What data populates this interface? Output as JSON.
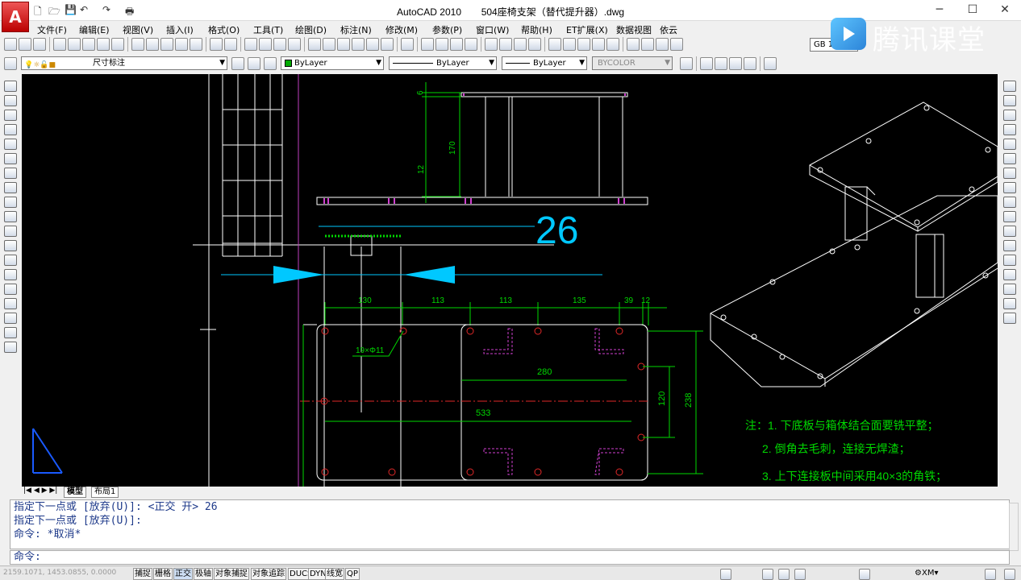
{
  "title": {
    "app": "AutoCAD 2010",
    "file": "504座椅支架（替代提升器）.dwg"
  },
  "window_controls": [
    "─",
    "☐",
    "✕"
  ],
  "menu": [
    "文件(F)",
    "编辑(E)",
    "视图(V)",
    "插入(I)",
    "格式(O)",
    "工具(T)",
    "绘图(D)",
    "标注(N)",
    "修改(M)",
    "参数(P)",
    "窗口(W)",
    "帮助(H)",
    "ET扩展(X)",
    "数据视图",
    "依云"
  ],
  "toolbar": {
    "layer_name": "尺寸标注",
    "color": "ByLayer",
    "linetype": "ByLayer",
    "lineweight": "ByLayer",
    "plotstyle": "BYCOLOR",
    "dimstyle_partial": "GB 1"
  },
  "watermark": "腾讯课堂",
  "drawing": {
    "dims": {
      "d6": "6",
      "d170": "170",
      "d12": "12",
      "d26": "26",
      "d130": "130",
      "d113a": "113",
      "d113b": "113",
      "d135": "135",
      "d39": "39",
      "d12b": "12",
      "d280": "280",
      "d120": "120",
      "d238": "238",
      "d533": "533",
      "holes": "19×Φ11"
    },
    "notes": [
      "注：1. 下底板与箱体结合面要铣平整；",
      "2. 倒角去毛刺，连接无焊渣；",
      "3. 上下连接板中间采用40×3的角铁；"
    ]
  },
  "tabs": [
    "模型",
    "布局1"
  ],
  "command_history": [
    "指定下一点或 [放弃(U)]:  <正交 开> 26",
    "指定下一点或 [放弃(U)]:",
    "命令: *取消*"
  ],
  "command_prompt": "命令:",
  "status": {
    "coords": "2159.1071, 1453.0855, 0.0000",
    "buttons": [
      "捕捉",
      "栅格",
      "正交",
      "极轴",
      "对象捕捉",
      "对象追踪",
      "DUCS",
      "DYN",
      "线宽",
      "QP"
    ],
    "active": [
      "正交"
    ],
    "annotation": "XM"
  },
  "colors": {
    "dim": "#00d800",
    "edge": "#ffffff",
    "accent_cyan": "#00c8ff",
    "hole": "#e02828",
    "layer_magenta": "#d040d0"
  }
}
